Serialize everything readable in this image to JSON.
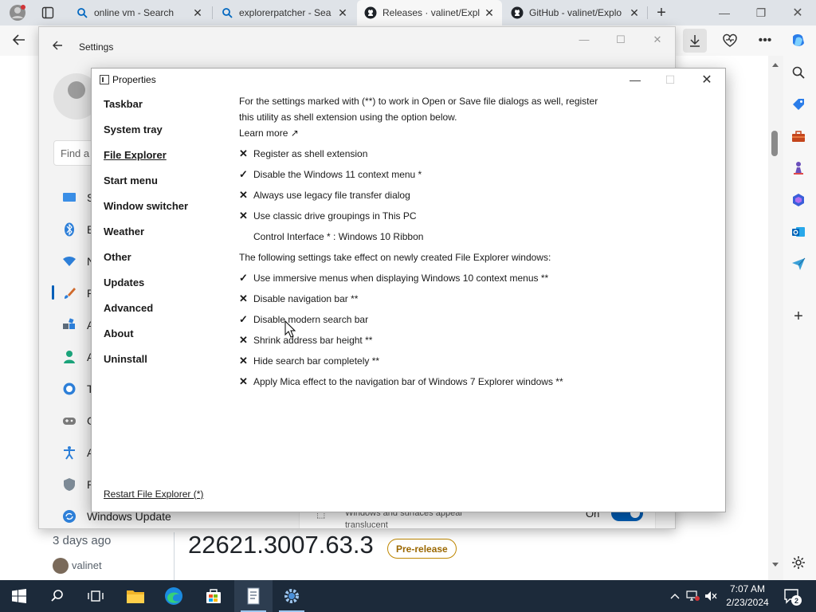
{
  "browser": {
    "tabs": [
      {
        "title": "online vm - Search",
        "icon": "search-icon"
      },
      {
        "title": "explorerpatcher - Sea",
        "icon": "search-icon"
      },
      {
        "title": "Releases · valinet/Expl",
        "icon": "github-icon",
        "active": true
      },
      {
        "title": "GitHub - valinet/Explo",
        "icon": "github-icon"
      }
    ],
    "new_tab_label": "+"
  },
  "github_page": {
    "days_ago": "3 days ago",
    "user": "valinet",
    "version": "22621.3007.63.3",
    "badge": "Pre-release"
  },
  "settings": {
    "title": "Settings",
    "search_placeholder": "Find a",
    "nav_letters": [
      "S",
      "B",
      "N",
      "P",
      "A",
      "A",
      "T",
      "G",
      "A",
      "P"
    ],
    "windows_update_label": "Windows Update",
    "card_text": "Windows and surfaces appear translucent",
    "toggle_label": "On"
  },
  "properties": {
    "title": "Properties",
    "categories": [
      "Taskbar",
      "System tray",
      "File Explorer",
      "Start menu",
      "Window switcher",
      "Weather",
      "Other",
      "Updates",
      "Advanced",
      "About",
      "Uninstall"
    ],
    "selected_category": "File Explorer",
    "intro_line1": "For the settings marked with (**) to work in Open or Save file dialogs as well, register",
    "intro_line2": "this utility as shell extension using the option below.",
    "learn_more": "Learn more ↗",
    "options_a": [
      {
        "label": "Register as shell extension",
        "checked": false
      },
      {
        "label": "Disable the Windows 11 context menu *",
        "checked": true
      },
      {
        "label": "Always use legacy file transfer dialog",
        "checked": false
      },
      {
        "label": "Use classic drive groupings in This PC",
        "checked": false
      }
    ],
    "control_interface": "Control Interface * : Windows 10 Ribbon",
    "section_note": "The following settings take effect on newly created File Explorer windows:",
    "options_b": [
      {
        "label": "Use immersive menus when displaying Windows 10 context menus **",
        "checked": true
      },
      {
        "label": "Disable navigation bar **",
        "checked": false
      },
      {
        "label": "Disable modern search bar",
        "checked": true
      },
      {
        "label": "Shrink address bar height **",
        "checked": false
      },
      {
        "label": "Hide search bar completely **",
        "checked": false
      },
      {
        "label": "Apply Mica effect to the navigation bar of Windows 7 Explorer windows **",
        "checked": false
      }
    ],
    "restart_link": "Restart File Explorer (*)"
  },
  "taskbar": {
    "time": "7:07 AM",
    "date": "2/23/2024",
    "notification_count": "2",
    "colors": {
      "taskbar_bg": "#1c2a3a",
      "accent": "#005fb8"
    }
  }
}
